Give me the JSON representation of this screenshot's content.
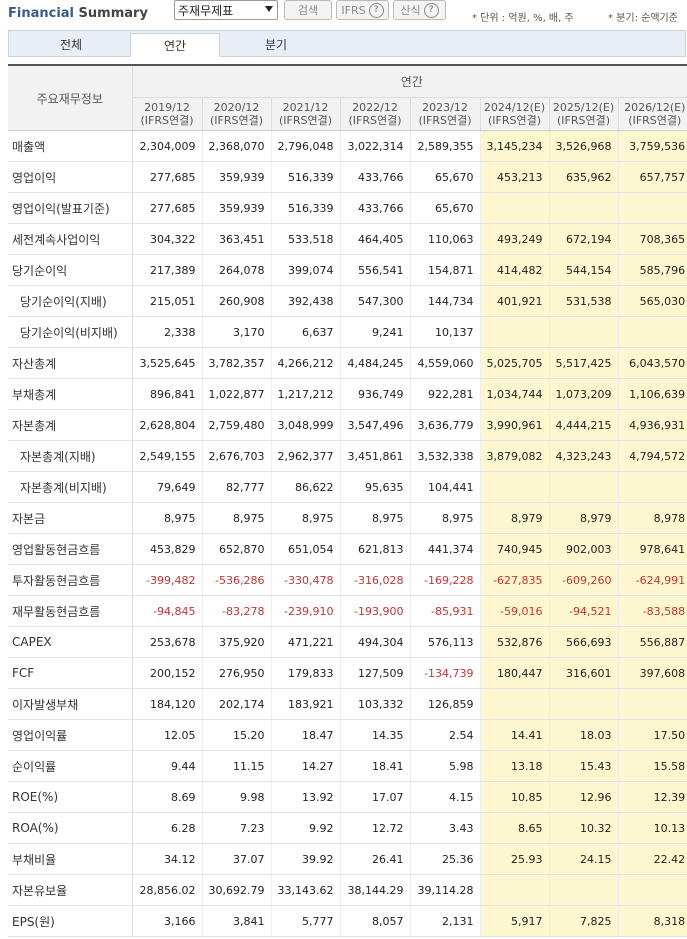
{
  "header": {
    "title_part1": "Financial",
    "title_part2": "Summary",
    "statement_select": "주재무제표",
    "search_label": "검색",
    "ifrs_label": "IFRS",
    "formula_label": "산식",
    "help_symbol": "?",
    "unit_note": "* 단위 : 억원, %, 배, 주",
    "period_note": "* 분기: 순액기준"
  },
  "tabs": [
    {
      "label": "전체"
    },
    {
      "label": "연간",
      "active": true
    },
    {
      "label": "분기"
    }
  ],
  "table": {
    "item_header": "주요재무정보",
    "period_header": "연간",
    "columns": [
      {
        "year": "2019/12",
        "basis": "(IFRS연결)",
        "estimate": false
      },
      {
        "year": "2020/12",
        "basis": "(IFRS연결)",
        "estimate": false
      },
      {
        "year": "2021/12",
        "basis": "(IFRS연결)",
        "estimate": false
      },
      {
        "year": "2022/12",
        "basis": "(IFRS연결)",
        "estimate": false
      },
      {
        "year": "2023/12",
        "basis": "(IFRS연결)",
        "estimate": false
      },
      {
        "year": "2024/12(E)",
        "basis": "(IFRS연결)",
        "estimate": true
      },
      {
        "year": "2025/12(E)",
        "basis": "(IFRS연결)",
        "estimate": true
      },
      {
        "year": "2026/12(E)",
        "basis": "(IFRS연결)",
        "estimate": true
      }
    ],
    "rows": [
      {
        "label": "매출액",
        "values": [
          "2,304,009",
          "2,368,070",
          "2,796,048",
          "3,022,314",
          "2,589,355",
          "3,145,234",
          "3,526,968",
          "3,759,536"
        ]
      },
      {
        "label": "영업이익",
        "values": [
          "277,685",
          "359,939",
          "516,339",
          "433,766",
          "65,670",
          "453,213",
          "635,962",
          "657,757"
        ]
      },
      {
        "label": "영업이익(발표기준)",
        "values": [
          "277,685",
          "359,939",
          "516,339",
          "433,766",
          "65,670",
          "",
          "",
          ""
        ]
      },
      {
        "label": "세전계속사업이익",
        "values": [
          "304,322",
          "363,451",
          "533,518",
          "464,405",
          "110,063",
          "493,249",
          "672,194",
          "708,365"
        ]
      },
      {
        "label": "당기순이익",
        "values": [
          "217,389",
          "264,078",
          "399,074",
          "556,541",
          "154,871",
          "414,482",
          "544,154",
          "585,796"
        ]
      },
      {
        "label": "당기순이익(지배)",
        "sub": true,
        "values": [
          "215,051",
          "260,908",
          "392,438",
          "547,300",
          "144,734",
          "401,921",
          "531,538",
          "565,030"
        ]
      },
      {
        "label": "당기순이익(비지배)",
        "sub": true,
        "values": [
          "2,338",
          "3,170",
          "6,637",
          "9,241",
          "10,137",
          "",
          "",
          ""
        ]
      },
      {
        "label": "자산총계",
        "values": [
          "3,525,645",
          "3,782,357",
          "4,266,212",
          "4,484,245",
          "4,559,060",
          "5,025,705",
          "5,517,425",
          "6,043,570"
        ]
      },
      {
        "label": "부채총계",
        "values": [
          "896,841",
          "1,022,877",
          "1,217,212",
          "936,749",
          "922,281",
          "1,034,744",
          "1,073,209",
          "1,106,639"
        ]
      },
      {
        "label": "자본총계",
        "values": [
          "2,628,804",
          "2,759,480",
          "3,048,999",
          "3,547,496",
          "3,636,779",
          "3,990,961",
          "4,444,215",
          "4,936,931"
        ]
      },
      {
        "label": "자본총계(지배)",
        "sub": true,
        "values": [
          "2,549,155",
          "2,676,703",
          "2,962,377",
          "3,451,861",
          "3,532,338",
          "3,879,082",
          "4,323,243",
          "4,794,572"
        ]
      },
      {
        "label": "자본총계(비지배)",
        "sub": true,
        "values": [
          "79,649",
          "82,777",
          "86,622",
          "95,635",
          "104,441",
          "",
          "",
          ""
        ]
      },
      {
        "label": "자본금",
        "values": [
          "8,975",
          "8,975",
          "8,975",
          "8,975",
          "8,975",
          "8,979",
          "8,979",
          "8,978"
        ]
      },
      {
        "label": "영업활동현금흐름",
        "values": [
          "453,829",
          "652,870",
          "651,054",
          "621,813",
          "441,374",
          "740,945",
          "902,003",
          "978,641"
        ]
      },
      {
        "label": "투자활동현금흐름",
        "values": [
          "-399,482",
          "-536,286",
          "-330,478",
          "-316,028",
          "-169,228",
          "-627,835",
          "-609,260",
          "-624,991"
        ]
      },
      {
        "label": "재무활동현금흐름",
        "values": [
          "-94,845",
          "-83,278",
          "-239,910",
          "-193,900",
          "-85,931",
          "-59,016",
          "-94,521",
          "-83,588"
        ]
      },
      {
        "label": "CAPEX",
        "values": [
          "253,678",
          "375,920",
          "471,221",
          "494,304",
          "576,113",
          "532,876",
          "566,693",
          "556,887"
        ]
      },
      {
        "label": "FCF",
        "values": [
          "200,152",
          "276,950",
          "179,833",
          "127,509",
          "-134,739",
          "180,447",
          "316,601",
          "397,608"
        ]
      },
      {
        "label": "이자발생부채",
        "values": [
          "184,120",
          "202,174",
          "183,921",
          "103,332",
          "126,859",
          "",
          "",
          ""
        ]
      },
      {
        "label": "영업이익률",
        "values": [
          "12.05",
          "15.20",
          "18.47",
          "14.35",
          "2.54",
          "14.41",
          "18.03",
          "17.50"
        ]
      },
      {
        "label": "순이익률",
        "values": [
          "9.44",
          "11.15",
          "14.27",
          "18.41",
          "5.98",
          "13.18",
          "15.43",
          "15.58"
        ]
      },
      {
        "label": "ROE(%)",
        "values": [
          "8.69",
          "9.98",
          "13.92",
          "17.07",
          "4.15",
          "10.85",
          "12.96",
          "12.39"
        ]
      },
      {
        "label": "ROA(%)",
        "values": [
          "6.28",
          "7.23",
          "9.92",
          "12.72",
          "3.43",
          "8.65",
          "10.32",
          "10.13"
        ]
      },
      {
        "label": "부채비율",
        "values": [
          "34.12",
          "37.07",
          "39.92",
          "26.41",
          "25.36",
          "25.93",
          "24.15",
          "22.42"
        ]
      },
      {
        "label": "자본유보율",
        "values": [
          "28,856.02",
          "30,692.79",
          "33,143.62",
          "38,144.29",
          "39,114.28",
          "",
          "",
          ""
        ]
      },
      {
        "label": "EPS(원)",
        "values": [
          "3,166",
          "3,841",
          "5,777",
          "8,057",
          "2,131",
          "5,917",
          "7,825",
          "8,318"
        ]
      }
    ]
  }
}
